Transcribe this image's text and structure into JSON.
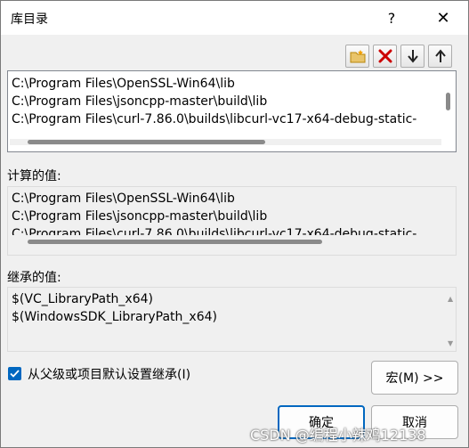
{
  "window": {
    "title": "库目录",
    "help": "?",
    "close": "✕"
  },
  "toolbar": {
    "new_line_icon": "folder-new-icon",
    "delete_icon": "delete-x-icon",
    "move_down_icon": "arrow-down-icon",
    "move_up_icon": "arrow-up-icon"
  },
  "editor": {
    "lines": [
      "C:\\Program Files\\OpenSSL-Win64\\lib",
      "C:\\Program Files\\jsoncpp-master\\build\\lib",
      "C:\\Program Files\\curl-7.86.0\\builds\\libcurl-vc17-x64-debug-static-"
    ]
  },
  "evaluated": {
    "label": "计算的值:",
    "lines": [
      "C:\\Program Files\\OpenSSL-Win64\\lib",
      "C:\\Program Files\\jsoncpp-master\\build\\lib",
      "C:\\Program Files\\curl-7.86.0\\builds\\libcurl-vc17-x64-debug-static-"
    ]
  },
  "inherited": {
    "label": "继承的值:",
    "lines": [
      "$(VC_LibraryPath_x64)",
      "$(WindowsSDK_LibraryPath_x64)"
    ]
  },
  "inherit_checkbox": {
    "label": "从父级或项目默认设置继承(I)",
    "checked": true
  },
  "buttons": {
    "macros": "宏(M) >>",
    "ok": "确定",
    "cancel": "取消"
  },
  "watermark": "CSDN @编程小辣鸡12138",
  "colors": {
    "accent": "#0067c0",
    "delete": "#cc0000"
  }
}
